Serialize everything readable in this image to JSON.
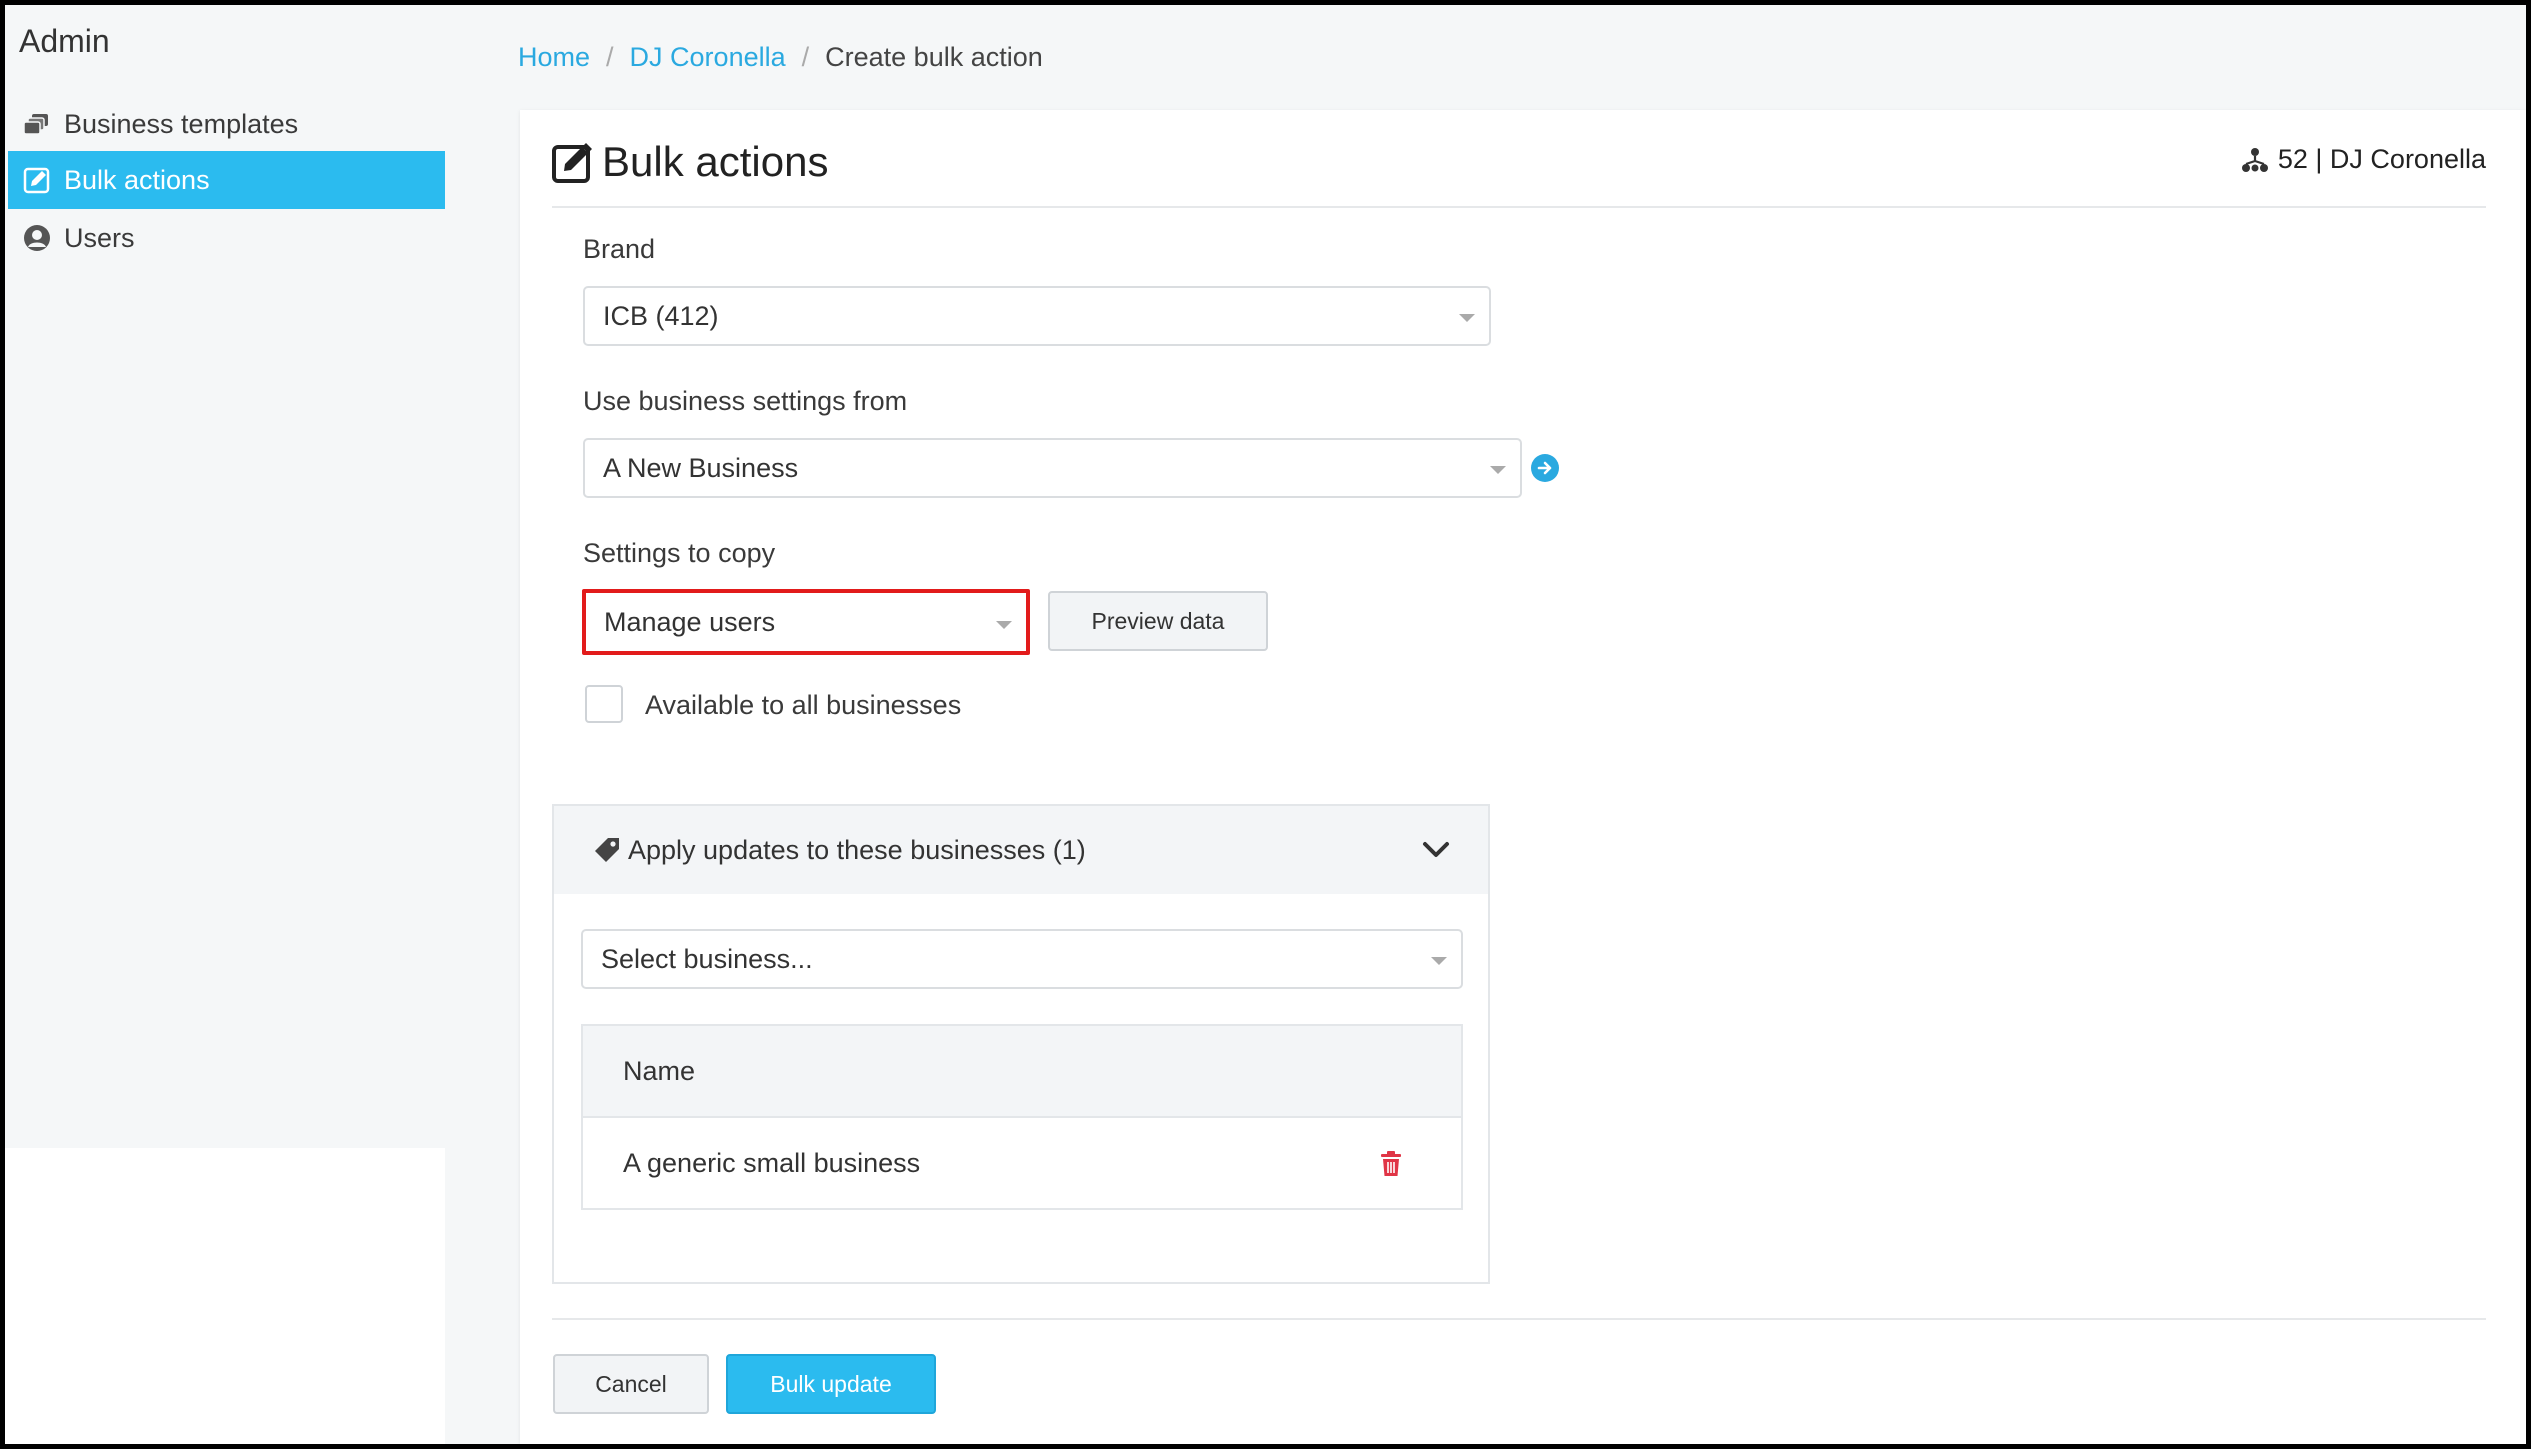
{
  "sidebar": {
    "title": "Admin",
    "items": [
      {
        "label": "Business templates",
        "icon": "templates-icon",
        "active": false
      },
      {
        "label": "Bulk actions",
        "icon": "edit-icon",
        "active": true
      },
      {
        "label": "Users",
        "icon": "user-circle-icon",
        "active": false
      }
    ]
  },
  "breadcrumb": {
    "home": "Home",
    "parent": "DJ Coronella",
    "current": "Create bulk action",
    "separator": "/"
  },
  "header": {
    "title": "Bulk actions",
    "account": "52 | DJ Coronella"
  },
  "form": {
    "brand": {
      "label": "Brand",
      "value": "ICB (412)"
    },
    "source": {
      "label": "Use business settings from",
      "value": "A New Business"
    },
    "settings": {
      "label": "Settings to copy",
      "value": "Manage users",
      "preview_button": "Preview data"
    },
    "available_all": {
      "label": "Available to all businesses",
      "checked": false
    }
  },
  "businesses_panel": {
    "title": "Apply updates to these businesses (1)",
    "select_placeholder": "Select business...",
    "table": {
      "columns": [
        "Name"
      ],
      "rows": [
        {
          "name": "A generic small business"
        }
      ]
    }
  },
  "footer": {
    "cancel": "Cancel",
    "submit": "Bulk update"
  },
  "colors": {
    "accent": "#2bbbef",
    "link": "#2aa9e0",
    "highlight": "#e21b1b",
    "delete": "#e03546"
  }
}
